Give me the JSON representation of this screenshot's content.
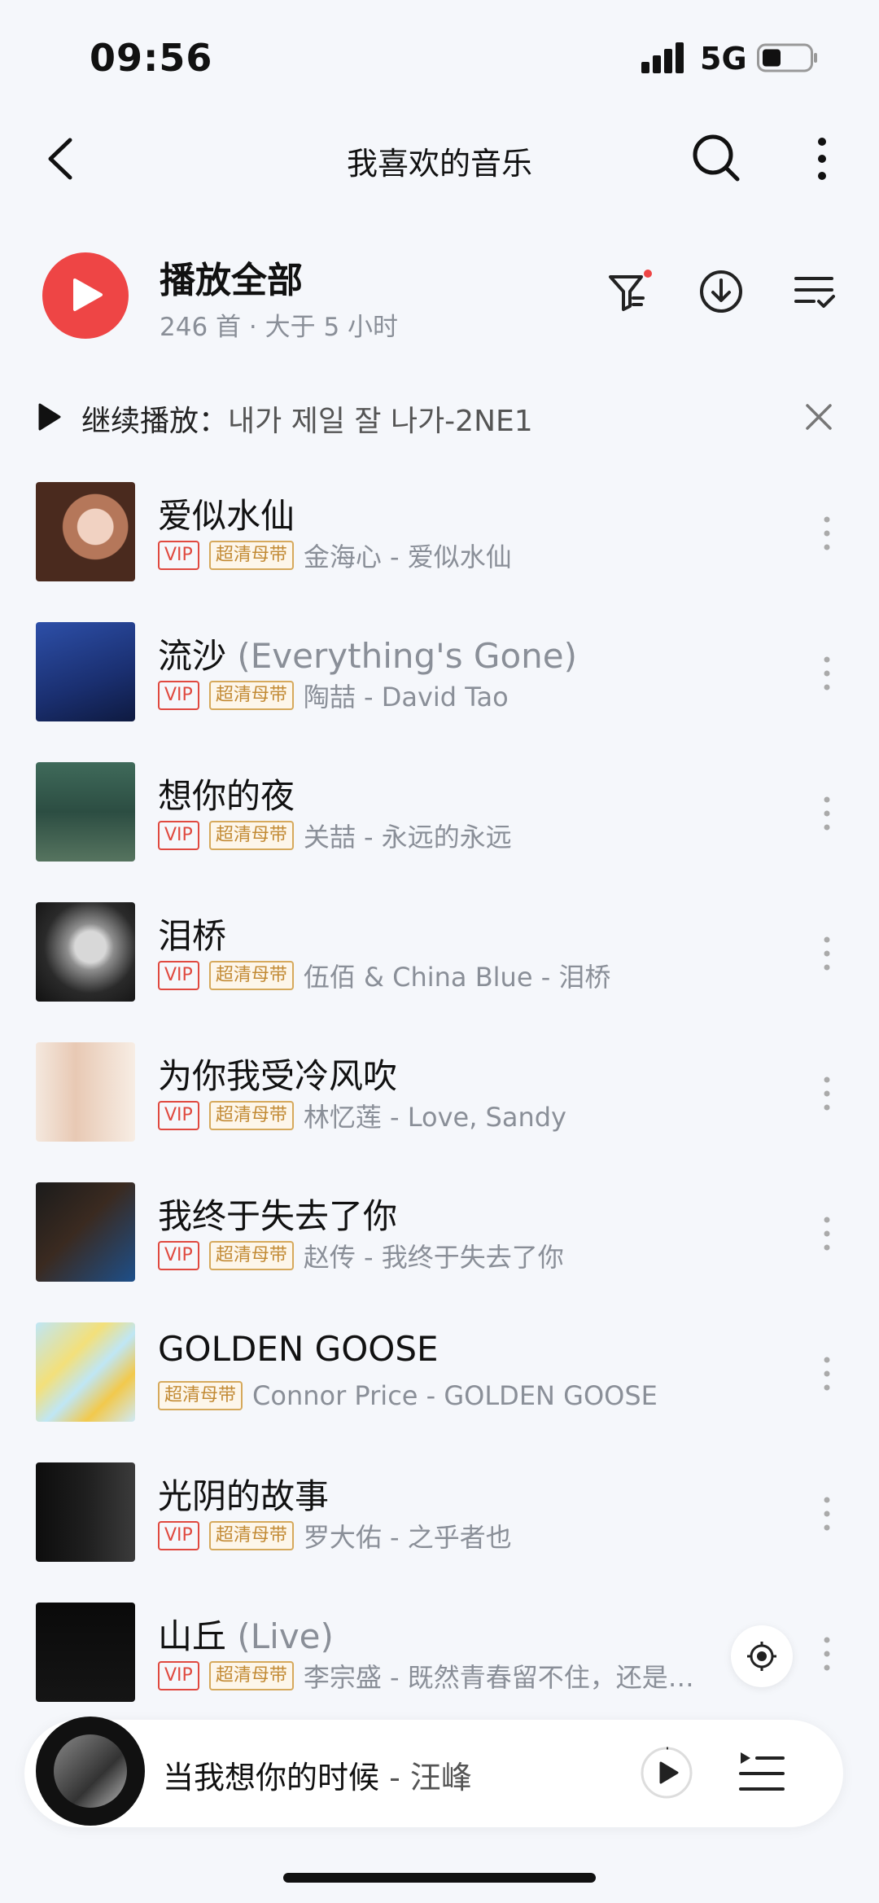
{
  "status_bar": {
    "time": "09:56",
    "network": "5G"
  },
  "nav": {
    "title": "我喜欢的音乐"
  },
  "play_all": {
    "label": "播放全部",
    "meta": "246 首 · 大于 5 小时"
  },
  "continue": {
    "label": "继续播放：",
    "song": "내가 제일 잘 나가-2NE1"
  },
  "songs": [
    {
      "title": "爱似水仙",
      "subtitle": "",
      "vip": "VIP",
      "quality": "超清母带",
      "artist": "金海心 - 爱似水仙"
    },
    {
      "title": "流沙",
      "subtitle": "(Everything's Gone)",
      "vip": "VIP",
      "quality": "超清母带",
      "artist": "陶喆 - David Tao"
    },
    {
      "title": "想你的夜",
      "subtitle": "",
      "vip": "VIP",
      "quality": "超清母带",
      "artist": "关喆 - 永远的永远"
    },
    {
      "title": "泪桥",
      "subtitle": "",
      "vip": "VIP",
      "quality": "超清母带",
      "artist": "伍佰 & China Blue - 泪桥"
    },
    {
      "title": "为你我受冷风吹",
      "subtitle": "",
      "vip": "VIP",
      "quality": "超清母带",
      "artist": "林忆莲 - Love, Sandy"
    },
    {
      "title": "我终于失去了你",
      "subtitle": "",
      "vip": "VIP",
      "quality": "超清母带",
      "artist": "赵传 - 我终于失去了你"
    },
    {
      "title": "GOLDEN GOOSE",
      "subtitle": "",
      "vip": "",
      "quality": "超清母带",
      "artist": "Connor Price - GOLDEN GOOSE"
    },
    {
      "title": "光阴的故事",
      "subtitle": "",
      "vip": "VIP",
      "quality": "超清母带",
      "artist": "罗大佑 - 之乎者也"
    },
    {
      "title": "山丘",
      "subtitle": "(Live)",
      "vip": "VIP",
      "quality": "超清母带",
      "artist": "李宗盛 - 既然青春留不住，还是…"
    }
  ],
  "mini_player": {
    "title": "当我想你的时候",
    "artist": " - 汪峰"
  },
  "colors": {
    "accent": "#ee4545",
    "vip": "#e0493f",
    "master": "#c28a34",
    "background": "#f5f7fb"
  }
}
